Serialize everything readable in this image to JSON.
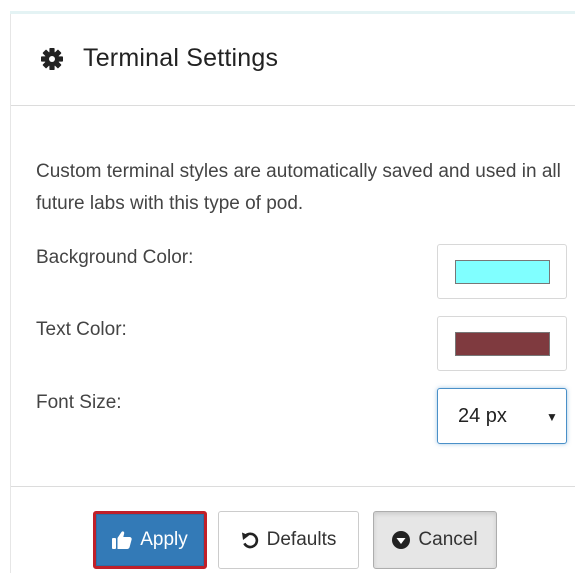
{
  "dialog": {
    "title": "Terminal Settings",
    "title_icon": "gear-icon",
    "description": "Custom terminal styles are automatically saved and used in all future labs with this type of pod."
  },
  "fields": {
    "background_color": {
      "label": "Background Color:",
      "value": "#80ffff"
    },
    "text_color": {
      "label": "Text Color:",
      "value": "#7f3a3f"
    },
    "font_size": {
      "label": "Font Size:",
      "selected": "24 px"
    }
  },
  "buttons": {
    "apply": {
      "label": "Apply",
      "icon": "thumbs-up-icon",
      "color": "#337ab7"
    },
    "defaults": {
      "label": "Defaults",
      "icon": "undo-icon"
    },
    "cancel": {
      "label": "Cancel",
      "icon": "circle-arrow-down-icon"
    }
  }
}
